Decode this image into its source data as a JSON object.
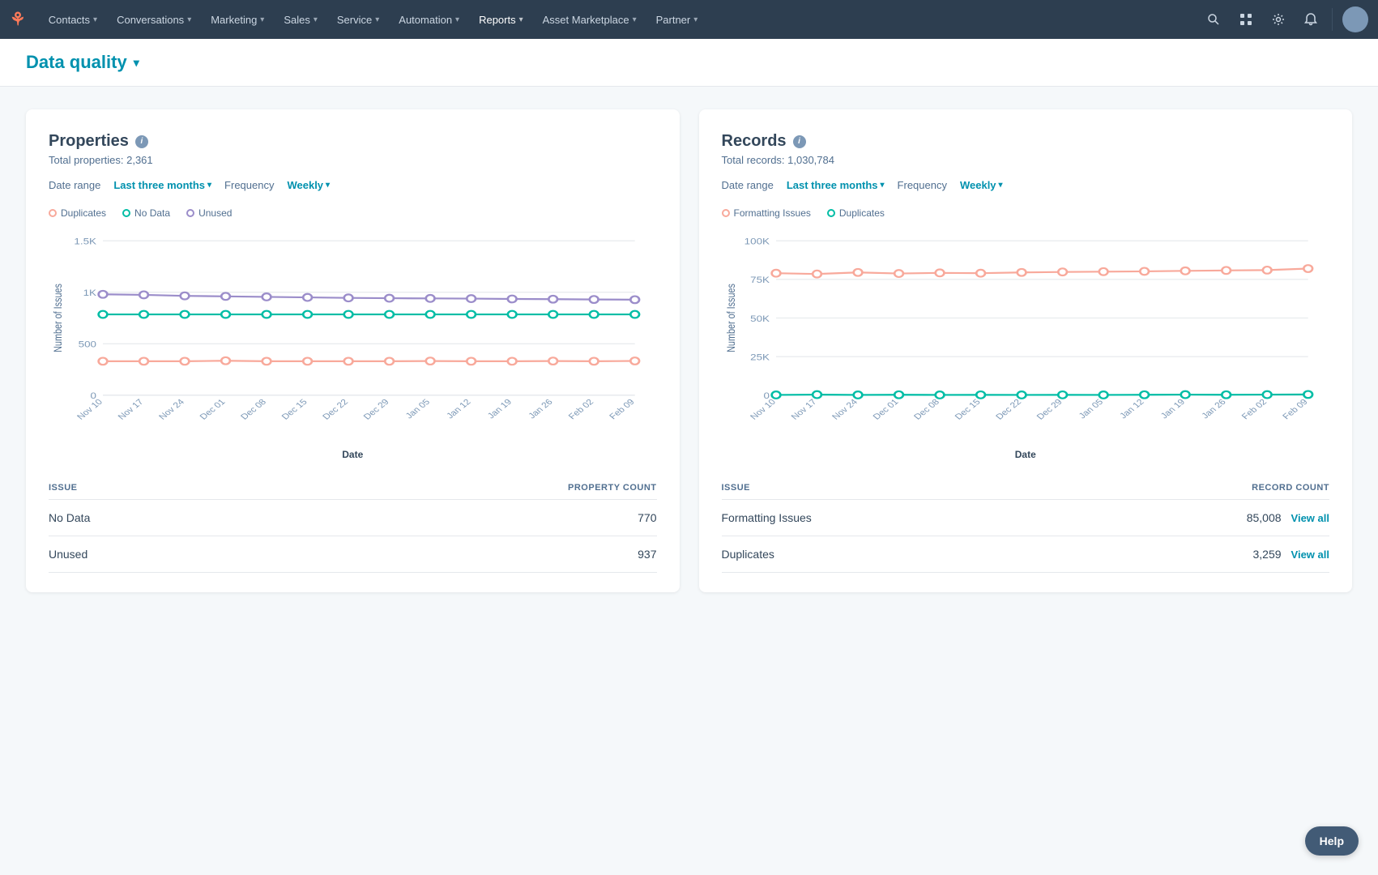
{
  "nav": {
    "logo": "H",
    "items": [
      {
        "label": "Contacts",
        "chevron": "▾",
        "active": false
      },
      {
        "label": "Conversations",
        "chevron": "▾",
        "active": false
      },
      {
        "label": "Marketing",
        "chevron": "▾",
        "active": false
      },
      {
        "label": "Sales",
        "chevron": "▾",
        "active": false
      },
      {
        "label": "Service",
        "chevron": "▾",
        "active": false
      },
      {
        "label": "Automation",
        "chevron": "▾",
        "active": false
      },
      {
        "label": "Reports",
        "chevron": "▾",
        "active": true
      },
      {
        "label": "Asset Marketplace",
        "chevron": "▾",
        "active": false
      },
      {
        "label": "Partner",
        "chevron": "▾",
        "active": false
      }
    ],
    "icons": [
      "🔍",
      "⊞",
      "⚙",
      "🔔"
    ],
    "avatar_initials": ""
  },
  "page": {
    "title": "Data quality",
    "dropdown_arrow": "▾"
  },
  "properties_card": {
    "title": "Properties",
    "subtitle": "Total properties: 2,361",
    "date_range_label": "Date range",
    "date_range_value": "Last three months",
    "frequency_label": "Frequency",
    "frequency_value": "Weekly",
    "legend": [
      {
        "label": "Duplicates",
        "color": "#f8a99b"
      },
      {
        "label": "No Data",
        "color": "#00bda5"
      },
      {
        "label": "Unused",
        "color": "#9b8dca"
      }
    ],
    "y_labels": [
      "1.5K",
      "1K",
      "500",
      "0"
    ],
    "x_labels": [
      "Nov 10",
      "Nov 17",
      "Nov 24",
      "Dec 01",
      "Dec 08",
      "Dec 15",
      "Dec 22",
      "Dec 29",
      "Jan 05",
      "Jan 12",
      "Jan 19",
      "Jan 26",
      "Feb 02",
      "Feb 09"
    ],
    "xlabel": "Date",
    "ylabel": "Number of Issues",
    "series": {
      "duplicates": {
        "color": "#f8a99b",
        "values": [
          330,
          330,
          330,
          335,
          330,
          330,
          330,
          330,
          332,
          330,
          330,
          332,
          330,
          333
        ]
      },
      "nodata": {
        "color": "#00bda5",
        "values": [
          785,
          785,
          785,
          785,
          785,
          785,
          785,
          785,
          785,
          785,
          785,
          785,
          785,
          785
        ]
      },
      "unused": {
        "color": "#9b8dca",
        "values": [
          980,
          975,
          965,
          960,
          955,
          950,
          945,
          942,
          940,
          938,
          935,
          933,
          930,
          928
        ]
      }
    },
    "table": {
      "col1": "ISSUE",
      "col2": "PROPERTY COUNT",
      "rows": [
        {
          "issue": "No Data",
          "count": "770",
          "view_all": false
        },
        {
          "issue": "Unused",
          "count": "937",
          "view_all": false
        }
      ]
    }
  },
  "records_card": {
    "title": "Records",
    "subtitle": "Total records: 1,030,784",
    "date_range_label": "Date range",
    "date_range_value": "Last three months",
    "frequency_label": "Frequency",
    "frequency_value": "Weekly",
    "legend": [
      {
        "label": "Formatting Issues",
        "color": "#f8a99b"
      },
      {
        "label": "Duplicates",
        "color": "#00bda5"
      }
    ],
    "y_labels": [
      "100K",
      "75K",
      "50K",
      "25K",
      "0"
    ],
    "x_labels": [
      "Nov 10",
      "Nov 17",
      "Nov 24",
      "Dec 01",
      "Dec 08",
      "Dec 15",
      "Dec 22",
      "Dec 29",
      "Jan 05",
      "Jan 12",
      "Jan 19",
      "Jan 26",
      "Feb 02",
      "Feb 09"
    ],
    "xlabel": "Date",
    "ylabel": "Number of Issues",
    "series": {
      "formatting": {
        "color": "#f8a99b",
        "values": [
          79000,
          78500,
          79500,
          78800,
          79200,
          79000,
          79500,
          79800,
          80000,
          80200,
          80500,
          80800,
          81000,
          82000
        ]
      },
      "duplicates": {
        "color": "#00bda5",
        "values": [
          200,
          400,
          200,
          300,
          200,
          250,
          200,
          250,
          200,
          300,
          400,
          300,
          400,
          500
        ]
      }
    },
    "table": {
      "col1": "ISSUE",
      "col2": "RECORD COUNT",
      "rows": [
        {
          "issue": "Formatting Issues",
          "count": "85,008",
          "view_all": true
        },
        {
          "issue": "Duplicates",
          "count": "3,259",
          "view_all": true
        }
      ]
    }
  },
  "help_button": "Help"
}
